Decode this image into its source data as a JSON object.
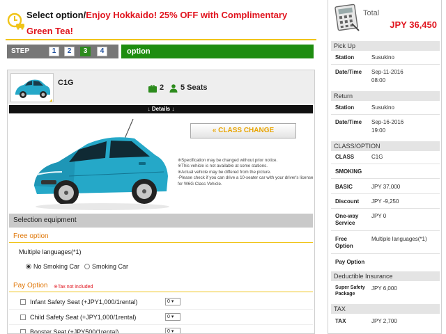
{
  "header": {
    "title_plain": "Select option/",
    "title_promo": "Enjoy Hokkaido! 25% OFF with Complimentary Green Tea!"
  },
  "steps": {
    "label": "STEP",
    "items": [
      "1",
      "2",
      "3",
      "4"
    ],
    "active": "3",
    "current_name": "option"
  },
  "car": {
    "name": "C1G",
    "bags": "2",
    "seats": "5 Seats",
    "details_label": "↓ Details ↓",
    "class_change_label": "CLASS CHANGE",
    "notes": [
      "※Specification may be changed without prior notice.",
      "※This vehicle is not available at some stations.",
      "※Actual vehicle may be differed from the picture.",
      "-Please check if you can drive a 10-seater car with your driver's license for W6G Class Vehicle."
    ],
    "colors": {
      "body": "#25a8c8",
      "dark": "#137592"
    }
  },
  "equipment": {
    "header": "Selection equipment",
    "free_title": "Free option",
    "multi_lang": "Multiple languages(*1)",
    "smoking_options": [
      "No Smoking Car",
      "Smoking Car"
    ],
    "smoking_selected": "No Smoking Car",
    "pay_title": "Pay Option",
    "pay_note": "※Tax not included",
    "pay_items": [
      {
        "label": "Infant Safety Seat (+JPY1,000/1rental)",
        "qty": "0"
      },
      {
        "label": "Child Safety Seat (+JPY1,000/1rental)",
        "qty": "0"
      },
      {
        "label": "Booster Seat (+JPY500/1rental)",
        "qty": "0"
      }
    ]
  },
  "summary": {
    "total_label": "Total",
    "total_price": "JPY 36,450",
    "pickup": {
      "heading": "Pick Up",
      "station_label": "Station",
      "station": "Susukino",
      "datetime_label": "Date/Time",
      "date": "Sep-11-2016",
      "time": "08:00"
    },
    "return": {
      "heading": "Return",
      "station_label": "Station",
      "station": "Susukino",
      "datetime_label": "Date/Time",
      "date": "Sep-16-2016",
      "time": "19:00"
    },
    "class_option": {
      "heading": "CLASS/OPTION",
      "class_label": "CLASS",
      "class_value": "C1G",
      "smoking_label": "SMOKING",
      "basic_label": "BASIC",
      "basic_value": "JPY 37,000",
      "discount_label": "Discount",
      "discount_value": "JPY -9,250",
      "oneway_label_1": "One-way",
      "oneway_label_2": "Service",
      "oneway_value": "JPY 0",
      "free_label_1": "Free",
      "free_label_2": "Option",
      "free_value": "Multiple languages(*1)",
      "pay_label": "Pay Option"
    },
    "deductible": {
      "heading": "Deductible Insurance",
      "label_1": "Super Safety",
      "label_2": "Package",
      "value": "JPY 6,000"
    },
    "tax": {
      "heading": "TAX",
      "label": "TAX",
      "value": "JPY 2,700"
    }
  },
  "accents": {
    "promo_red": "#e0141e",
    "step_green": "#1e8d10",
    "gold": "#f0c419"
  }
}
